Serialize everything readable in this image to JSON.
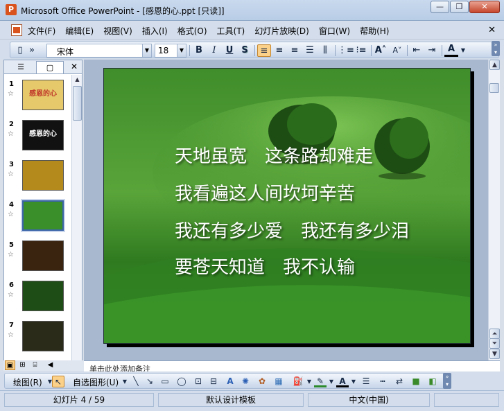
{
  "window": {
    "title": "Microsoft Office PowerPoint - [感恩的心.ppt [只读]]",
    "minimize": "—",
    "restore": "❐",
    "close": "✕"
  },
  "menu": {
    "items": [
      "文件(F)",
      "编辑(E)",
      "视图(V)",
      "插入(I)",
      "格式(O)",
      "工具(T)",
      "幻灯片放映(D)",
      "窗口(W)",
      "帮助(H)"
    ],
    "close": "✕"
  },
  "format_toolbar": {
    "font": "宋体",
    "size": "18",
    "bold": "B",
    "italic": "I",
    "underline": "U",
    "shadow": "S",
    "font_color_label": "A"
  },
  "slides_panel": {
    "tab_outline_icon": "outline-icon",
    "tab_slides_icon": "slides-icon",
    "close": "✕",
    "thumbnails": [
      {
        "num": "1",
        "caption": "感恩的心",
        "bg": "#e6c96a"
      },
      {
        "num": "2",
        "caption": "感恩的心",
        "bg": "#111111"
      },
      {
        "num": "3",
        "caption": "",
        "bg": "#b58a1c"
      },
      {
        "num": "4",
        "caption": "",
        "bg": "#3b8f2a"
      },
      {
        "num": "5",
        "caption": "",
        "bg": "#3a2410"
      },
      {
        "num": "6",
        "caption": "",
        "bg": "#1f4d16"
      },
      {
        "num": "7",
        "caption": "",
        "bg": "#2b2b1a"
      }
    ],
    "selected_index": 4
  },
  "slide": {
    "lines": [
      "天地虽宽　这条路却难走",
      "我看遍这人间坎坷辛苦",
      "我还有多少爱　我还有多少泪",
      "要苍天知道　我不认输"
    ]
  },
  "notes": {
    "placeholder": "单击此处添加备注"
  },
  "draw_toolbar": {
    "draw_label": "绘图(R)",
    "autoshapes_label": "自选图形(U)"
  },
  "status": {
    "slide_info": "幻灯片 4 / 59",
    "template": "默认设计模板",
    "language": "中文(中国)"
  }
}
